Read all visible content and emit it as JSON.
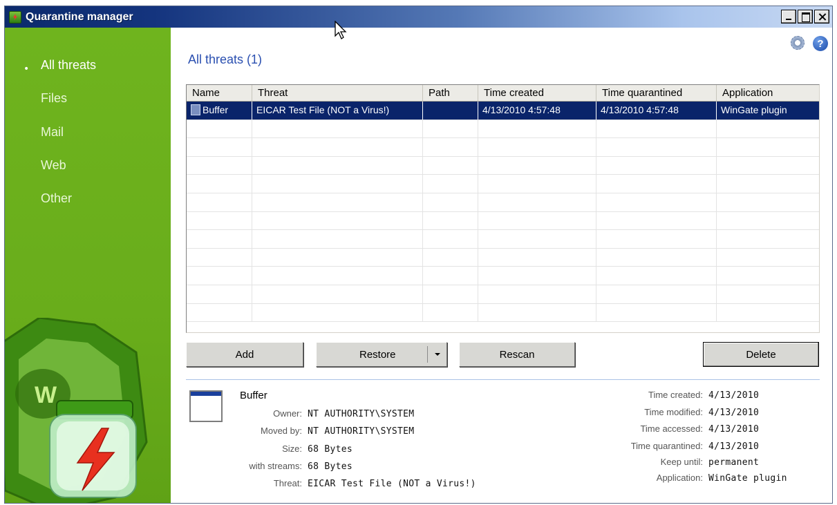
{
  "window": {
    "title": "Quarantine manager"
  },
  "sidebar": {
    "items": [
      {
        "label": "All threats",
        "active": true
      },
      {
        "label": "Files"
      },
      {
        "label": "Mail"
      },
      {
        "label": "Web"
      },
      {
        "label": "Other"
      }
    ],
    "bullet": "•"
  },
  "main": {
    "heading": "All threats (1)",
    "icons": [
      "settings-gear-icon",
      "help-icon"
    ],
    "help_glyph": "?",
    "table": {
      "columns": [
        "Name",
        "Threat",
        "Path",
        "Time created",
        "Time quarantined",
        "Application"
      ],
      "rows": [
        {
          "name": "Buffer",
          "threat": "EICAR Test File (NOT a Virus!)",
          "path": "",
          "time_created": "4/13/2010 4:57:48",
          "time_quarantined": "4/13/2010 4:57:48",
          "application": "WinGate plugin",
          "selected": true
        }
      ]
    },
    "buttons": {
      "add": "Add",
      "restore": "Restore",
      "rescan": "Rescan",
      "delete": "Delete"
    }
  },
  "details": {
    "name": "Buffer",
    "left": [
      {
        "label": "Owner:",
        "value": "NT AUTHORITY\\SYSTEM"
      },
      {
        "label": "Moved by:",
        "value": "NT AUTHORITY\\SYSTEM"
      },
      {
        "label": "Size:",
        "value": "68 Bytes"
      },
      {
        "label": "with streams:",
        "value": "68 Bytes"
      },
      {
        "label": "Threat:",
        "value": "EICAR Test File (NOT a Virus!)"
      }
    ],
    "right": [
      {
        "label": "Time created:",
        "value": "4/13/2010"
      },
      {
        "label": "Time modified:",
        "value": "4/13/2010"
      },
      {
        "label": "Time accessed:",
        "value": "4/13/2010"
      },
      {
        "label": "Time quarantined:",
        "value": "4/13/2010"
      },
      {
        "label": "Keep until:",
        "value": "permanent"
      },
      {
        "label": "Application:",
        "value": "WinGate plugin"
      }
    ]
  },
  "colors": {
    "sidebar": "#6fb41e",
    "selection": "#0a246a",
    "heading": "#2a4fb0"
  }
}
